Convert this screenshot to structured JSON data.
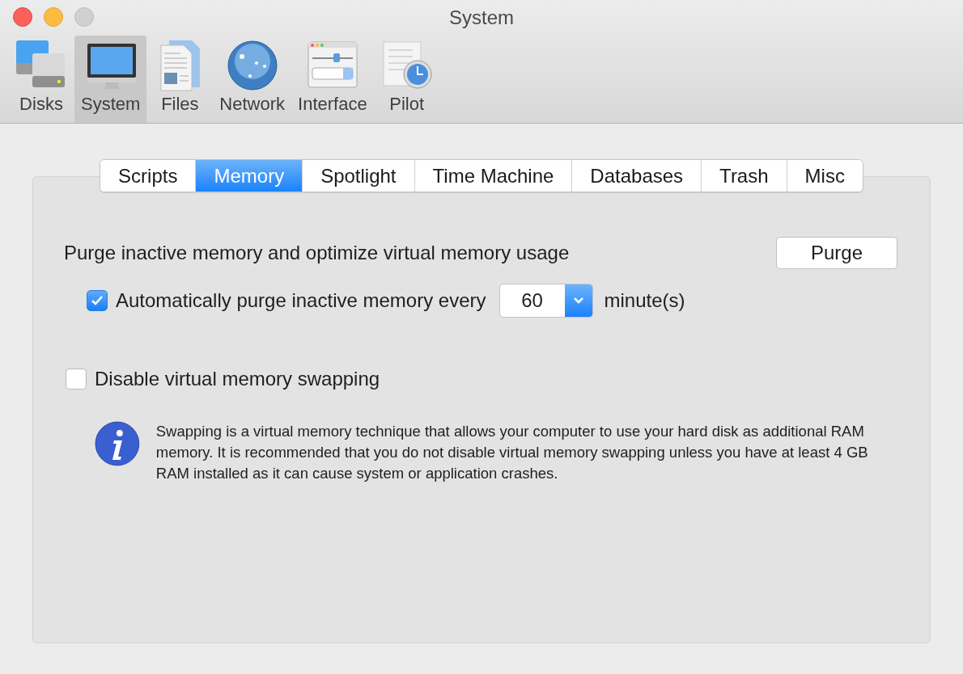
{
  "window": {
    "title": "System"
  },
  "toolbar": [
    {
      "label": "Disks",
      "kind": "disks",
      "selected": false
    },
    {
      "label": "System",
      "kind": "monitor",
      "selected": true
    },
    {
      "label": "Files",
      "kind": "files",
      "selected": false
    },
    {
      "label": "Network",
      "kind": "globe",
      "selected": false
    },
    {
      "label": "Interface",
      "kind": "interface",
      "selected": false
    },
    {
      "label": "Pilot",
      "kind": "pilot",
      "selected": false
    }
  ],
  "tabs": [
    {
      "label": "Scripts",
      "selected": false
    },
    {
      "label": "Memory",
      "selected": true
    },
    {
      "label": "Spotlight",
      "selected": false
    },
    {
      "label": "Time Machine",
      "selected": false
    },
    {
      "label": "Databases",
      "selected": false
    },
    {
      "label": "Trash",
      "selected": false
    },
    {
      "label": "Misc",
      "selected": false
    }
  ],
  "purge": {
    "label": "Purge inactive memory and optimize virtual memory usage",
    "button": "Purge"
  },
  "auto_purge": {
    "label": "Automatically purge inactive memory every",
    "checked": true,
    "value": "60",
    "unit": "minute(s)"
  },
  "disable_swap": {
    "label": "Disable virtual memory swapping",
    "checked": false
  },
  "info": "Swapping is a virtual memory technique that allows your computer to use your hard disk as additional RAM memory. It is recommended that you do not disable virtual memory swapping unless you have at least 4 GB RAM installed as it can cause system or application crashes."
}
